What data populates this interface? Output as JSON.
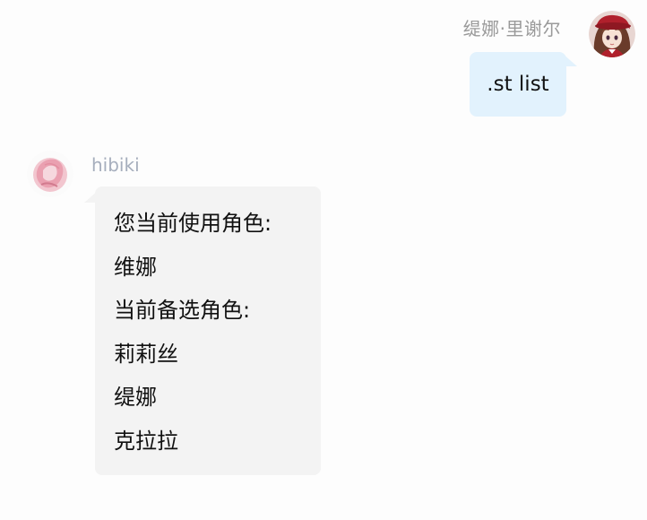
{
  "outgoing": {
    "sender_name": "缇娜·里谢尔",
    "avatar_icon": "anime-girl-red-hat-avatar",
    "message": ".st list",
    "bubble_color": "#e2f2fd"
  },
  "incoming": {
    "sender_name": "hibiki",
    "avatar_icon": "pink-sketch-avatar",
    "bubble_color": "#f3f3f3",
    "lines": [
      "您当前使用角色:",
      "维娜",
      "当前备选角色:",
      "莉莉丝",
      "缇娜",
      "克拉拉"
    ]
  }
}
